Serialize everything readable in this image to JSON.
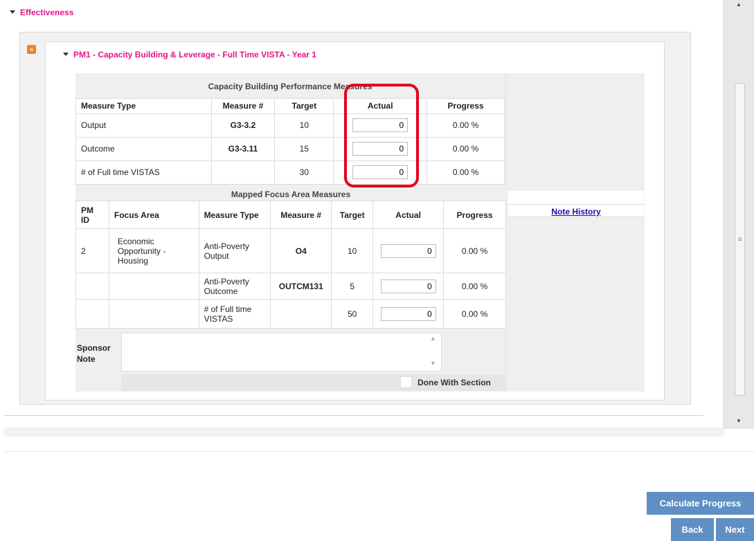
{
  "section": {
    "title": "Effectiveness"
  },
  "pm": {
    "title": "PM1 - Capacity Building & Leverage - Full Time VISTA - Year 1"
  },
  "capacity_table": {
    "caption": "Capacity Building Performance Measures",
    "headers": [
      "Measure Type",
      "Measure #",
      "Target",
      "Actual",
      "Progress"
    ],
    "rows": [
      {
        "type": "Output",
        "measure": "G3-3.2",
        "target": "10",
        "actual": "0",
        "progress": "0.00 %"
      },
      {
        "type": "Outcome",
        "measure": "G3-3.11",
        "target": "15",
        "actual": "0",
        "progress": "0.00 %"
      },
      {
        "type": "# of Full time VISTAS",
        "measure": "",
        "target": "30",
        "actual": "0",
        "progress": "0.00 %"
      }
    ]
  },
  "focus_table": {
    "caption": "Mapped Focus Area Measures",
    "headers": [
      "PM ID",
      "Focus Area",
      "Measure Type",
      "Measure #",
      "Target",
      "Actual",
      "Progress"
    ],
    "rows": [
      {
        "pm_id": "2",
        "focus_area": "Economic Opportunity - Housing",
        "type": "Anti-Poverty Output",
        "measure": "O4",
        "target": "10",
        "actual": "0",
        "progress": "0.00 %"
      },
      {
        "pm_id": "",
        "focus_area": "",
        "type": "Anti-Poverty Outcome",
        "measure": "OUTCM131",
        "target": "5",
        "actual": "0",
        "progress": "0.00 %"
      },
      {
        "pm_id": "",
        "focus_area": "",
        "type": "# of Full time VISTAS",
        "measure": "",
        "target": "50",
        "actual": "0",
        "progress": "0.00 %"
      }
    ]
  },
  "note_history_link": "Note History",
  "sponsor_note": {
    "label": "Sponsor Note",
    "value": ""
  },
  "done_with_section": {
    "label": "Done With Section",
    "checked": false
  },
  "buttons": {
    "calculate": "Calculate Progress",
    "back": "Back",
    "next": "Next"
  },
  "colors": {
    "accent_pink": "#e2168a",
    "button_blue": "#5f8fc4",
    "highlight_red": "#e5001c"
  }
}
